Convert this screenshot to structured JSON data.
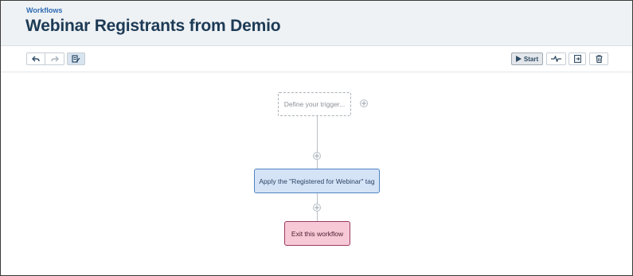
{
  "header": {
    "breadcrumb": "Workflows",
    "title": "Webinar Registrants from Demio"
  },
  "toolbar": {
    "undo_icon": "undo-icon",
    "redo_icon": "redo-icon",
    "edit_icon": "edit-settings-icon",
    "start_label": "Start",
    "start_icon": "play-icon",
    "activity_icon": "activity-pulse-icon",
    "export_icon": "export-icon",
    "delete_icon": "trash-icon"
  },
  "workflow": {
    "trigger_placeholder": "Define your trigger...",
    "action_label": "Apply the \"Registered for Webinar\" tag",
    "exit_label": "Exit this workflow",
    "add_icon": "plus-circle-icon"
  },
  "colors": {
    "accent": "#2f6bb3",
    "title": "#1d3a55",
    "action_fill": "#d5e3f6",
    "action_border": "#4f84c4",
    "exit_fill": "#f7c9d7",
    "exit_border": "#9c3a5e"
  }
}
